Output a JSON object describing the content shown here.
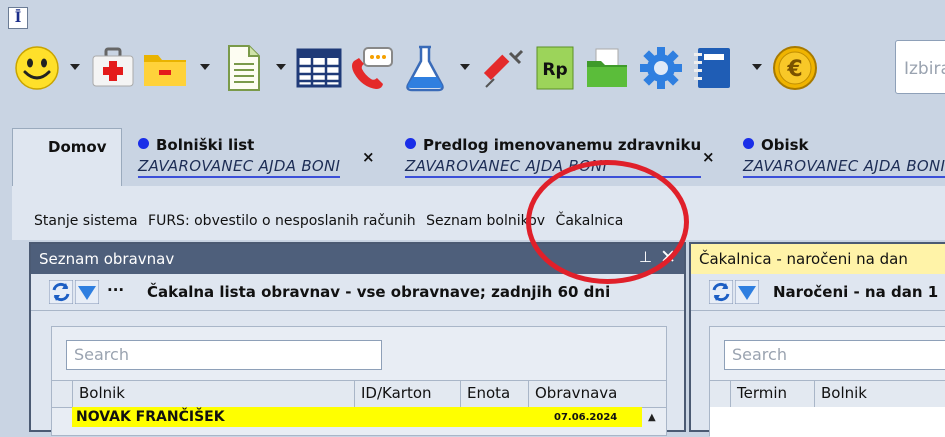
{
  "app": {
    "icon_glyph": "Ī"
  },
  "toolbar": {
    "items": [
      {
        "name": "smiley-icon",
        "glyph": "☺"
      },
      {
        "name": "first-aid-kit-icon"
      },
      {
        "name": "yellow-folder-icon"
      },
      {
        "name": "document-icon"
      },
      {
        "name": "table-grid-icon"
      },
      {
        "name": "phone-chat-icon"
      },
      {
        "name": "flask-icon"
      },
      {
        "name": "syringe-icon"
      },
      {
        "name": "prescription-rp-icon",
        "text": "Rp"
      },
      {
        "name": "green-folder-icon"
      },
      {
        "name": "gear-icon"
      },
      {
        "name": "notebook-icon"
      },
      {
        "name": "euro-coin-icon",
        "text": "€"
      }
    ],
    "search_placeholder": "Izbira"
  },
  "tabs": [
    {
      "title": "Domov"
    },
    {
      "title": "Bolniški list",
      "subtitle": "ZAVAROVANEC AJDA BONI",
      "close": "×"
    },
    {
      "title": "Predlog imenovanemu zdravniku",
      "subtitle": "ZAVAROVANEC AJDA BONI",
      "close": "×"
    },
    {
      "title": "Obisk",
      "subtitle": "ZAVAROVANEC AJDA BONI"
    }
  ],
  "links": [
    "Stanje sistema",
    "FURS: obvestilo o nesposlanih računih",
    "Seznam bolnikov",
    "Čakalnica"
  ],
  "left_pane": {
    "title": "Seznam obravnav",
    "pin": "⊥",
    "close": "✕",
    "more": "···",
    "subtitle": "Čakalna lista obravnav - vse obravnave; zadnjih 60 dni",
    "search_placeholder": "Search",
    "columns": [
      "Bolnik",
      "ID/Karton",
      "Enota",
      "Obravnava"
    ],
    "rows": [
      {
        "bolnik": "NOVAK FRANČIŠEK",
        "obravnava": "07.06.2024"
      }
    ]
  },
  "right_pane": {
    "title": "Čakalnica - naročeni na dan",
    "subtitle": "Naročeni - na dan 1",
    "search_placeholder": "Search",
    "columns": [
      "Termin",
      "Bolnik"
    ]
  },
  "colors": {
    "accent_blue": "#1a2ee8",
    "highlight_row": "#ffff00",
    "annotation_circle": "#e0202a",
    "pane_header": "#4e5f7b"
  }
}
